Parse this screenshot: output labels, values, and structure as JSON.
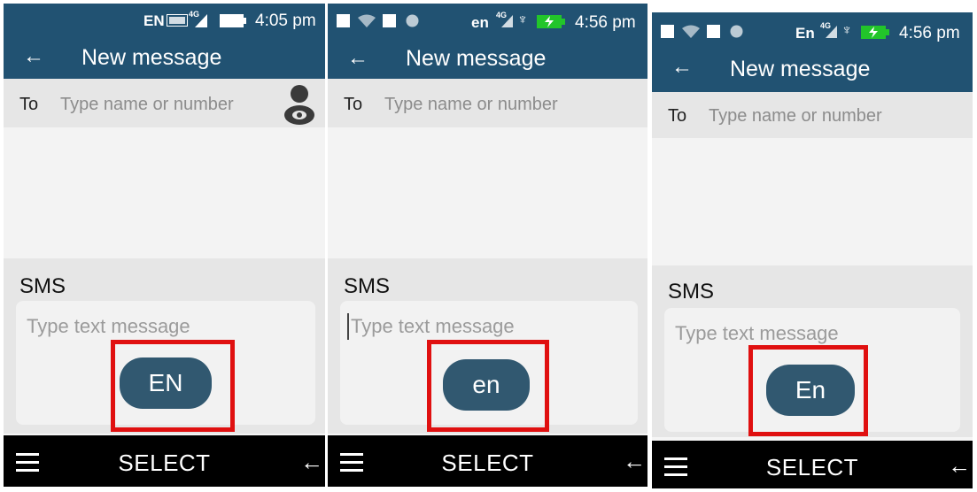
{
  "panels": [
    {
      "status": {
        "lang": "EN",
        "network": "4G",
        "time": "4:05 pm"
      },
      "header": {
        "title": "New message"
      },
      "recipient": {
        "label": "To",
        "placeholder": "Type name or number"
      },
      "sms": {
        "label": "SMS",
        "placeholder": "Type text message"
      },
      "input_mode": "EN",
      "softkeys": {
        "center": "SELECT"
      }
    },
    {
      "status": {
        "lang": "en",
        "network": "4G",
        "time": "4:56 pm"
      },
      "header": {
        "title": "New message"
      },
      "recipient": {
        "label": "To",
        "placeholder": "Type name or number"
      },
      "sms": {
        "label": "SMS",
        "placeholder": "Type text message"
      },
      "input_mode": "en",
      "softkeys": {
        "center": "SELECT"
      }
    },
    {
      "status": {
        "lang": "En",
        "network": "4G",
        "time": "4:56 pm"
      },
      "header": {
        "title": "New message"
      },
      "recipient": {
        "label": "To",
        "placeholder": "Type name or number"
      },
      "sms": {
        "label": "SMS",
        "placeholder": "Type text message"
      },
      "input_mode": "En",
      "softkeys": {
        "center": "SELECT"
      }
    }
  ],
  "icons": {
    "back": "back-arrow-icon",
    "contact": "contact-picker-icon",
    "menu": "menu-icon",
    "softback": "back-arrow-icon"
  },
  "colors": {
    "header": "#215272",
    "highlight": "#e01010",
    "pill": "#315870",
    "softkey_bar": "#000000"
  }
}
